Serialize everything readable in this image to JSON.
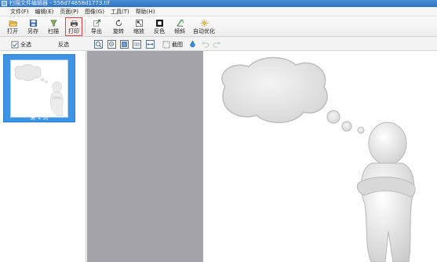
{
  "window": {
    "title": "扫描文件编辑器 - 556d74858d1773.tif"
  },
  "menu": [
    "文件(F)",
    "编辑(E)",
    "页面(P)",
    "图像(G)",
    "工具(T)",
    "帮助(H)"
  ],
  "toolbar": {
    "open": "打开",
    "save_as": "另存",
    "scan": "扫描",
    "print": "打印",
    "export": "导出",
    "rotate": "旋转",
    "zoom": "缩放",
    "invert": "反色",
    "deskew": "倾斜",
    "auto_optimize": "自动优化"
  },
  "subbar": {
    "select_all": "全选",
    "invert_selection": "反选",
    "crop": "截图"
  },
  "thumbnails": [
    {
      "label": "第 1 页",
      "selected": true
    }
  ],
  "colors": {
    "selection_blue": "#3d93e4",
    "title_blue": "#2f73c2",
    "workspace_gray": "#a4a4a8",
    "print_highlight": "#e04040"
  },
  "icons": {
    "open": "folder-open-icon",
    "save_as": "save-icon",
    "scan": "scan-icon",
    "print": "printer-icon",
    "export": "export-icon",
    "rotate": "rotate-icon",
    "zoom": "zoom-icon",
    "invert": "invert-icon",
    "deskew": "deskew-icon",
    "auto_optimize": "brightness-icon"
  }
}
